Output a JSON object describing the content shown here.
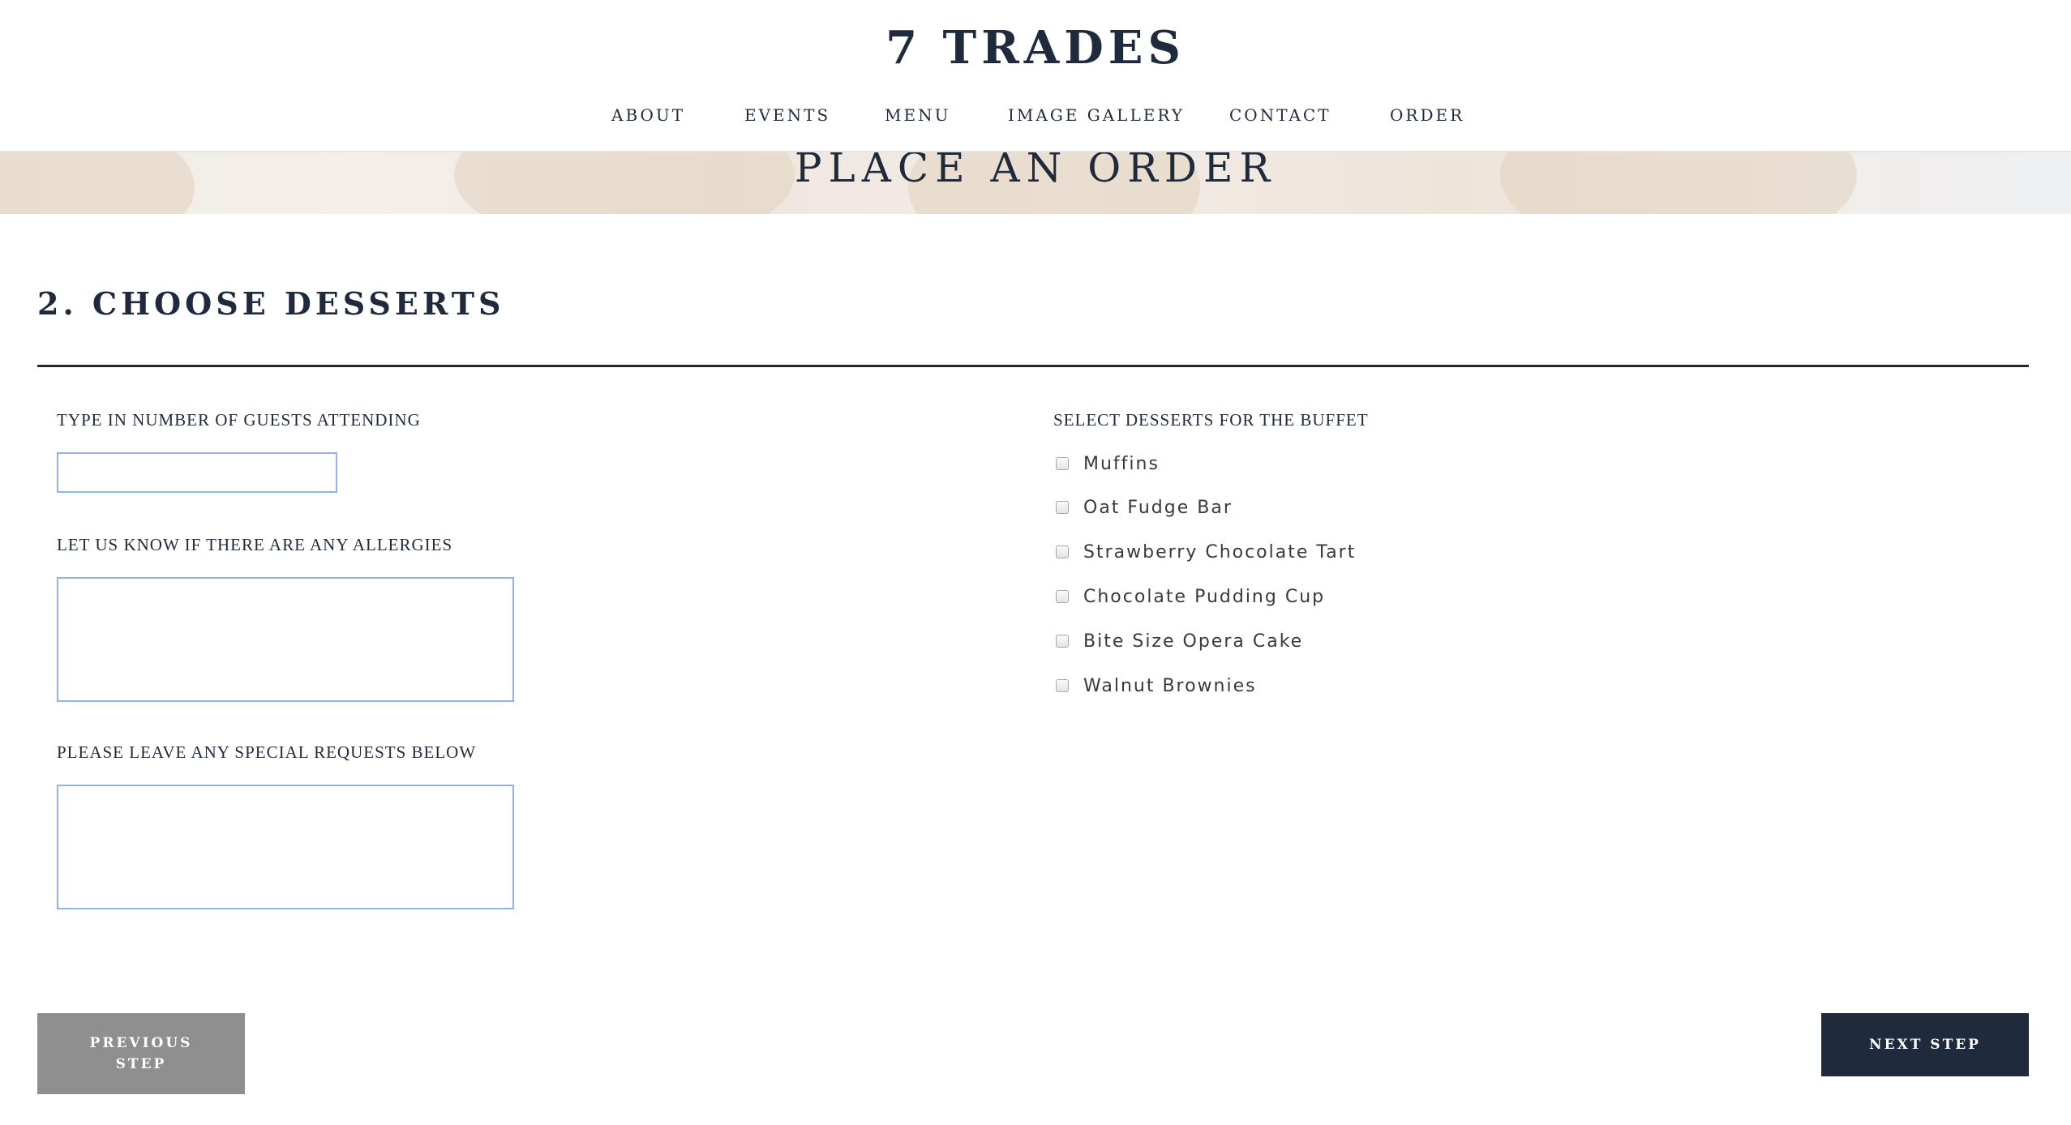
{
  "header": {
    "logo": "7 TRADES",
    "nav": [
      "ABOUT",
      "EVENTS",
      "MENU",
      "IMAGE GALLERY",
      "CONTACT",
      "ORDER"
    ]
  },
  "hero": {
    "title": "PLACE AN ORDER"
  },
  "step": {
    "title": "2. CHOOSE DESSERTS"
  },
  "form": {
    "guests_label": "TYPE IN NUMBER OF GUESTS ATTENDING",
    "guests_value": "",
    "allergies_label": "LET US KNOW IF THERE ARE ANY ALLERGIES",
    "allergies_value": "",
    "requests_label": "PLEASE LEAVE ANY SPECIAL REQUESTS BELOW",
    "requests_value": "",
    "desserts_label": "SELECT DESSERTS FOR THE BUFFET",
    "desserts": [
      {
        "label": "Muffins",
        "checked": false
      },
      {
        "label": "Oat Fudge Bar",
        "checked": false
      },
      {
        "label": "Strawberry Chocolate Tart",
        "checked": false
      },
      {
        "label": "Chocolate Pudding Cup",
        "checked": false
      },
      {
        "label": "Bite Size Opera Cake",
        "checked": false
      },
      {
        "label": "Walnut Brownies",
        "checked": false
      }
    ]
  },
  "buttons": {
    "previous": "PREVIOUS STEP",
    "next": "NEXT STEP"
  },
  "colors": {
    "brand": "#1f2b3d",
    "previous_button": "#8f8f8f",
    "input_border": "#8fb3e8"
  }
}
